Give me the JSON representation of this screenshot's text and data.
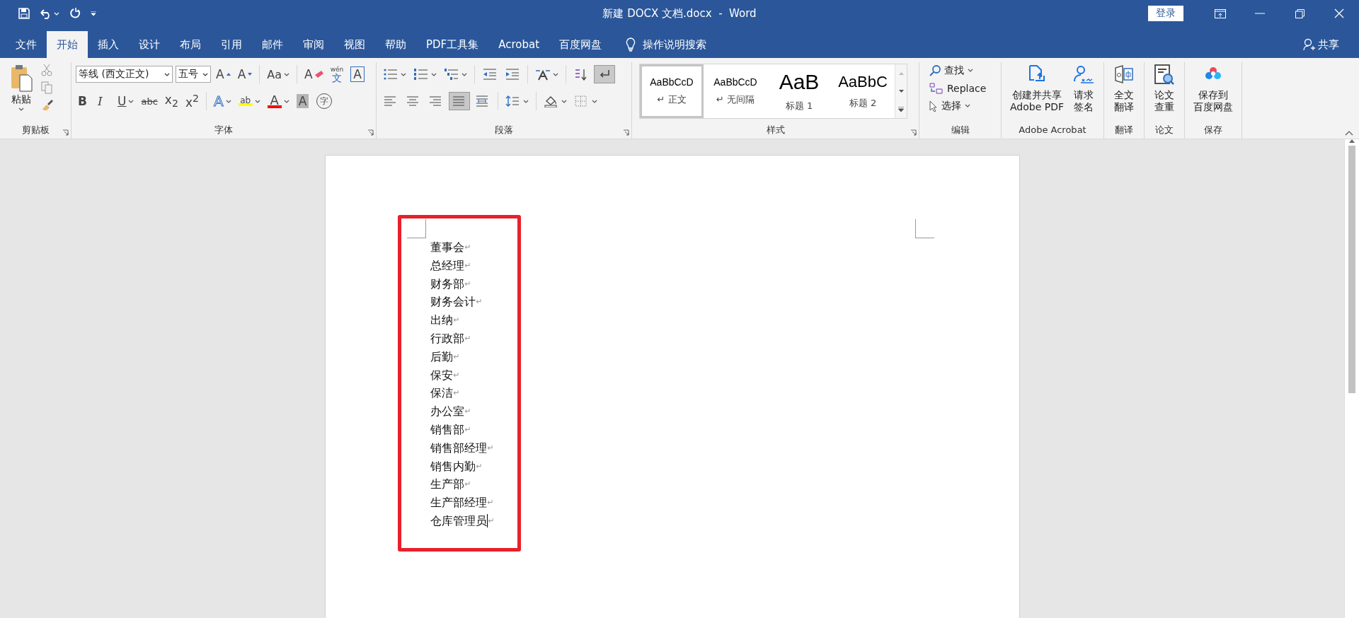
{
  "title_bar": {
    "title": "新建 DOCX 文档.docx  -  Word",
    "login_button": "登录"
  },
  "menu_tabs": [
    {
      "label": "文件",
      "selected": false
    },
    {
      "label": "开始",
      "selected": true
    },
    {
      "label": "插入",
      "selected": false
    },
    {
      "label": "设计",
      "selected": false
    },
    {
      "label": "布局",
      "selected": false
    },
    {
      "label": "引用",
      "selected": false
    },
    {
      "label": "邮件",
      "selected": false
    },
    {
      "label": "审阅",
      "selected": false
    },
    {
      "label": "视图",
      "selected": false
    },
    {
      "label": "帮助",
      "selected": false
    },
    {
      "label": "PDF工具集",
      "selected": false
    },
    {
      "label": "Acrobat",
      "selected": false
    },
    {
      "label": "百度网盘",
      "selected": false
    }
  ],
  "tell_me": "操作说明搜索",
  "share": "共享",
  "clipboard": {
    "paste": "粘贴",
    "group_label": "剪贴板"
  },
  "font": {
    "font_name": "等线 (西文正文)",
    "font_size": "五号",
    "group_label": "字体",
    "row1": [
      {
        "kind": "grow",
        "text": "A"
      },
      {
        "kind": "shrink",
        "text": "A"
      },
      {
        "kind": "case",
        "text": "Aa"
      },
      {
        "kind": "clear",
        "text": "A"
      },
      {
        "kind": "phonetic",
        "text": "文",
        "over": "wén"
      },
      {
        "kind": "border",
        "text": "A"
      }
    ],
    "row2": [
      {
        "kind": "bold",
        "text": "B"
      },
      {
        "kind": "italic",
        "text": "I"
      },
      {
        "kind": "underline",
        "text": "U"
      },
      {
        "kind": "strike",
        "text": "abc"
      },
      {
        "kind": "subscript",
        "text": "x$_{2}$"
      },
      {
        "kind": "superscript",
        "text": "x$^{2}$"
      },
      {
        "kind": "effects",
        "text": "A"
      },
      {
        "kind": "highlight",
        "text": "ab",
        "color": "#ffff00"
      },
      {
        "kind": "fontcolor",
        "text": "A",
        "color": "#ff0000"
      },
      {
        "kind": "shade",
        "text": "A"
      },
      {
        "kind": "enclose",
        "text": "字"
      }
    ]
  },
  "paragraph": {
    "group_label": "段落",
    "row1": [
      {
        "kind": "bullets",
        "selected": false
      },
      {
        "kind": "numbering",
        "selected": false
      },
      {
        "kind": "multilevel",
        "selected": false
      },
      {
        "kind": "outdent",
        "selected": false
      },
      {
        "kind": "indent",
        "selected": false
      },
      {
        "kind": "asian",
        "selected": false
      },
      {
        "kind": "sort",
        "selected": false
      },
      {
        "kind": "marks",
        "selected": true
      }
    ],
    "row2": [
      {
        "kind": "left",
        "selected": false
      },
      {
        "kind": "center",
        "selected": false
      },
      {
        "kind": "right",
        "selected": false
      },
      {
        "kind": "justify",
        "selected": true
      },
      {
        "kind": "distribute",
        "selected": false
      },
      {
        "kind": "spacing",
        "selected": false
      },
      {
        "kind": "shading",
        "selected": false
      },
      {
        "kind": "borders",
        "selected": false
      }
    ]
  },
  "styles": {
    "group_label": "样式",
    "items": [
      {
        "preview": "AaBbCcD",
        "name": "↵ 正文",
        "kind": "normal",
        "selected": true
      },
      {
        "preview": "AaBbCcD",
        "name": "↵ 无间隔",
        "kind": "normal",
        "selected": false
      },
      {
        "preview": "AaB",
        "name": "标题 1",
        "kind": "heading1",
        "selected": false
      },
      {
        "preview": "AaBbC",
        "name": "标题 2",
        "kind": "heading2",
        "selected": false
      }
    ]
  },
  "editing": {
    "find": "查找",
    "replace": "Replace",
    "select": "选择",
    "group_label": "编辑"
  },
  "large_groups": [
    {
      "label": "Adobe Acrobat",
      "buttons": [
        {
          "kind": "pdf",
          "lines": [
            "创建并共享",
            "Adobe PDF"
          ]
        },
        {
          "kind": "sign",
          "lines": [
            "请求",
            "签名"
          ]
        }
      ]
    },
    {
      "label": "翻译",
      "buttons": [
        {
          "kind": "translate",
          "lines": [
            "全文",
            "翻译"
          ]
        }
      ]
    },
    {
      "label": "论文",
      "buttons": [
        {
          "kind": "check",
          "lines": [
            "论文",
            "查重"
          ]
        }
      ]
    },
    {
      "label": "保存",
      "buttons": [
        {
          "kind": "cloud",
          "lines": [
            "保存到",
            "百度网盘"
          ]
        }
      ]
    }
  ],
  "document": {
    "paragraph_mark": "↵",
    "lines": [
      {
        "text": "董事会",
        "cursor": false
      },
      {
        "text": "总经理",
        "cursor": false
      },
      {
        "text": "财务部",
        "cursor": false
      },
      {
        "text": "财务会计",
        "cursor": false
      },
      {
        "text": "出纳",
        "cursor": false
      },
      {
        "text": "行政部",
        "cursor": false
      },
      {
        "text": "后勤",
        "cursor": false
      },
      {
        "text": "保安",
        "cursor": false
      },
      {
        "text": "保洁",
        "cursor": false
      },
      {
        "text": "办公室",
        "cursor": false
      },
      {
        "text": "销售部",
        "cursor": false
      },
      {
        "text": "销售部经理",
        "cursor": false
      },
      {
        "text": "销售内勤",
        "cursor": false
      },
      {
        "text": "生产部",
        "cursor": false
      },
      {
        "text": "生产部经理",
        "cursor": false
      },
      {
        "text": "仓库管理员",
        "cursor": true
      }
    ]
  }
}
